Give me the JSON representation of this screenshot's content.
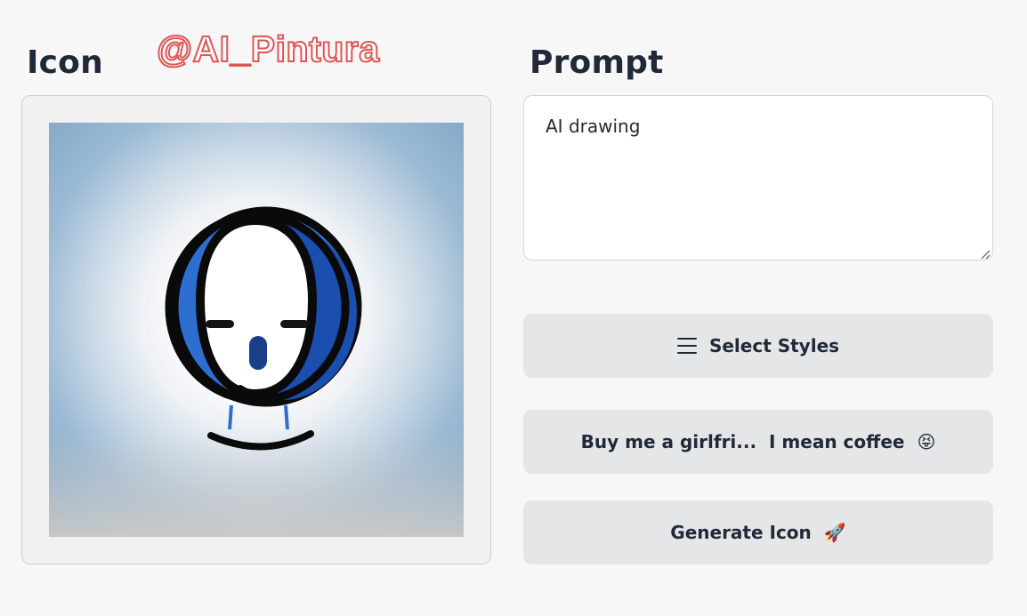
{
  "headings": {
    "icon": "Icon",
    "prompt": "Prompt"
  },
  "watermark": "@AI_Pintura",
  "prompt": {
    "value": "AI drawing"
  },
  "buttons": {
    "select_styles": "Select Styles",
    "coffee": "Buy me a girlfri...  I mean coffee",
    "coffee_emoji": "😝",
    "generate": "Generate Icon",
    "generate_emoji": "🚀"
  },
  "icons": {
    "menu": "menu-icon",
    "resize": "resize-handle-icon"
  },
  "colors": {
    "background": "#f7f7f7",
    "button_bg": "#e4e6e7",
    "text": "#1f2937",
    "watermark_stroke": "#e05555"
  }
}
